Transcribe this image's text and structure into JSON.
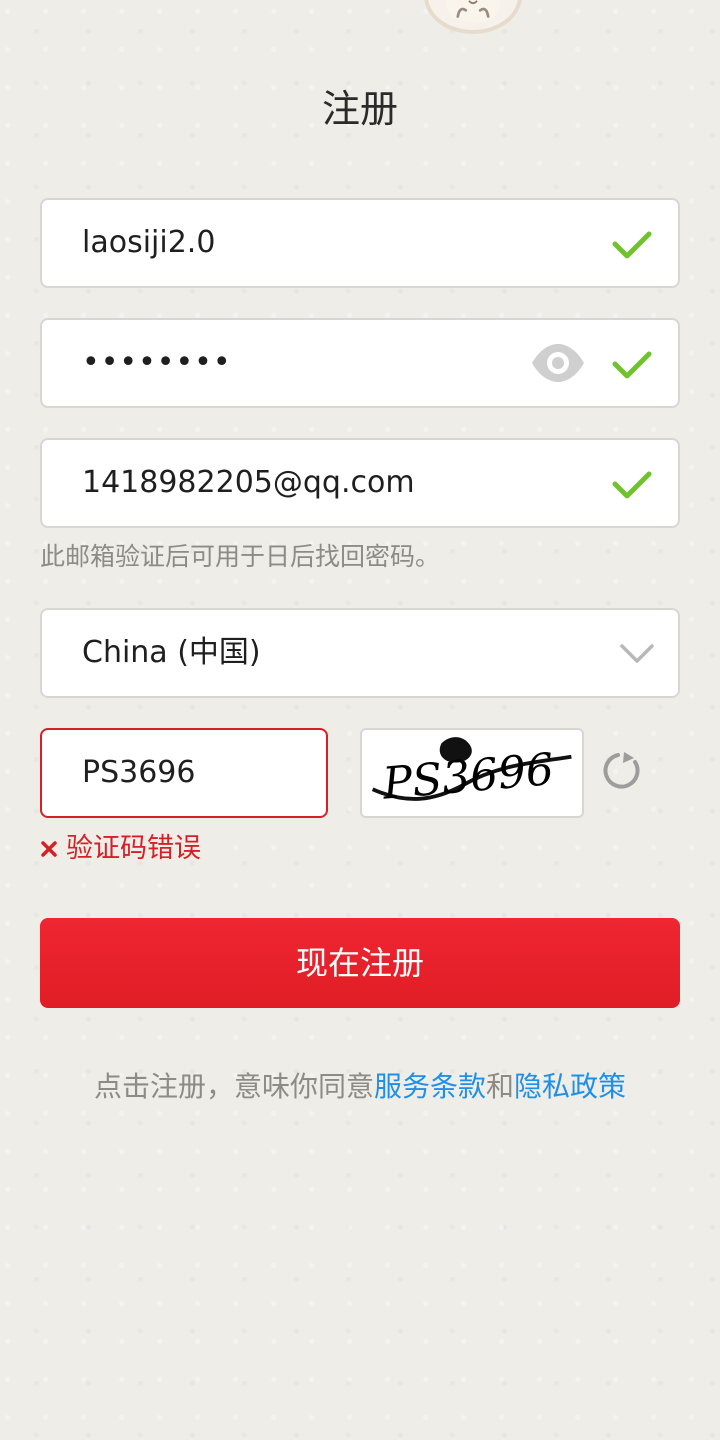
{
  "page": {
    "title": "注册"
  },
  "form": {
    "username": {
      "value": "laosiji2.0",
      "status_icon": "check-icon",
      "status_color": "#71c32d"
    },
    "password": {
      "value": "••••••••",
      "visibility_icon": "eye-icon",
      "status_icon": "check-icon",
      "status_color": "#71c32d"
    },
    "email": {
      "value": "1418982205@qq.com",
      "status_icon": "check-icon",
      "status_color": "#71c32d",
      "helper_text": "此邮箱验证后可用于日后找回密码。"
    },
    "country": {
      "selected": "China (中国)",
      "dropdown_icon": "chevron-down-icon"
    },
    "captcha": {
      "value": "PS3696",
      "image_text": "PS3696",
      "refresh_icon": "refresh-icon",
      "error_icon": "close-icon",
      "error_text": "验证码错误",
      "error_color": "#d71f26"
    }
  },
  "actions": {
    "submit_label": "现在注册",
    "submit_color": "#e11f27"
  },
  "agreement": {
    "prefix": "点击注册，意味你同意",
    "terms_link": "服务条款",
    "middle": "和",
    "privacy_link": "隐私政策",
    "link_color": "#1f90e8"
  }
}
